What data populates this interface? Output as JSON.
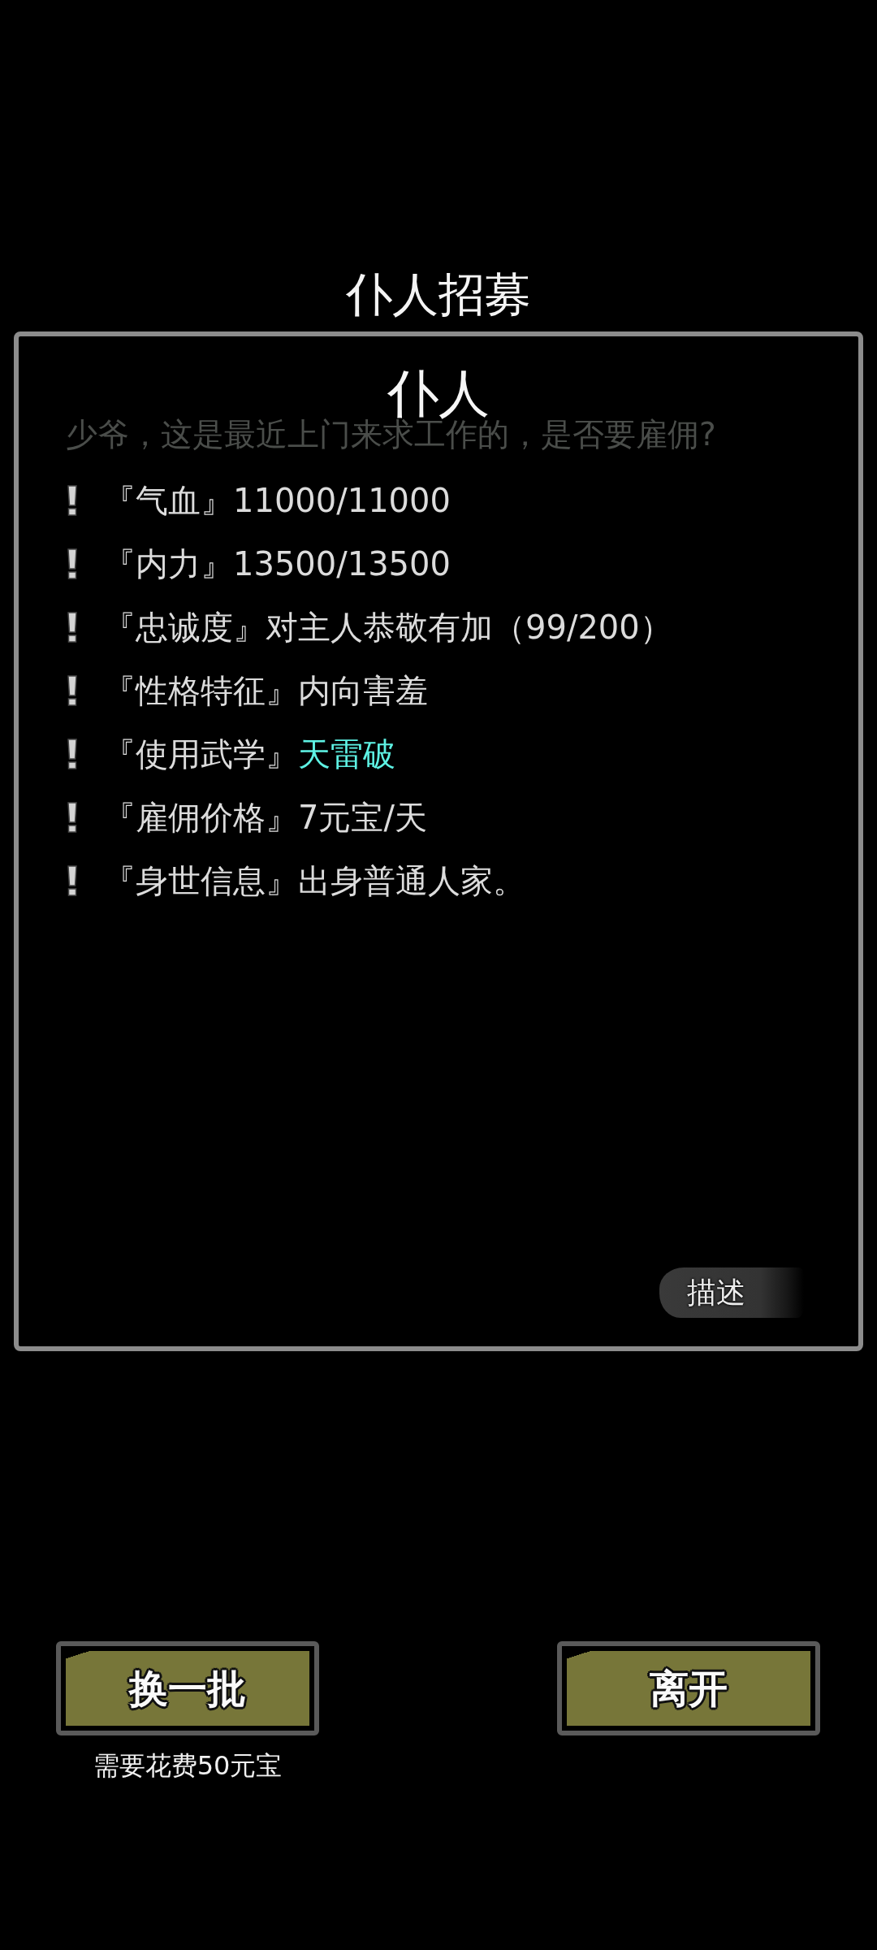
{
  "title": "仆人招募",
  "panel": {
    "heading": "仆人",
    "background_prompt": "少爷，这是最近上门来求工作的，是否要雇佣?",
    "attributes": [
      {
        "label": "『气血』",
        "value": "11000/11000",
        "color": "#dcdcdc"
      },
      {
        "label": "『内力』",
        "value": "13500/13500",
        "color": "#dcdcdc"
      },
      {
        "label": "『忠诚度』",
        "value": "对主人恭敬有加（99/200）",
        "color": "#dcdcdc"
      },
      {
        "label": "『性格特征』",
        "value": "内向害羞",
        "color": "#dcdcdc"
      },
      {
        "label": "『使用武学』",
        "value": "天雷破",
        "color": "#5ef2e4"
      },
      {
        "label": "『雇佣价格』",
        "value": "7元宝/天",
        "color": "#dcdcdc"
      },
      {
        "label": "『身世信息』",
        "value": "出身普通人家。",
        "color": "#dcdcdc"
      }
    ],
    "describe_button": "描述"
  },
  "actions": [
    {
      "label": "换一批",
      "note": "需要花费50元宝"
    },
    {
      "label": "离开"
    }
  ]
}
